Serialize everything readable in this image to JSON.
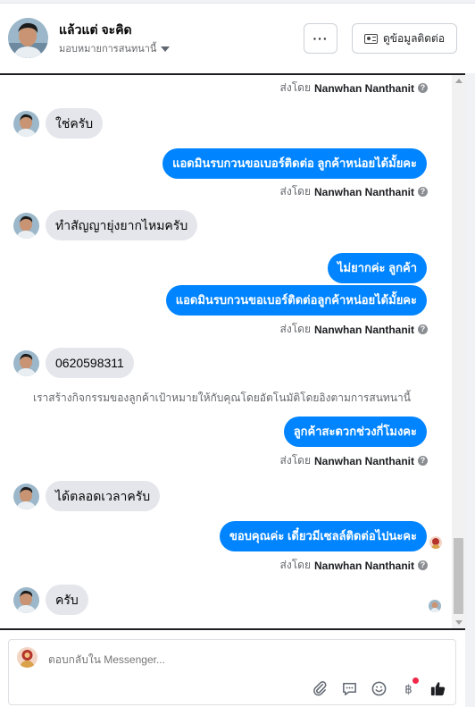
{
  "header": {
    "name": "แล้วแต่ จะคิด",
    "assign_label": "มอบหมายการสนทนานี้",
    "more_label": "···",
    "contact_label": "ดูข้อมูลติดต่อ"
  },
  "messages": {
    "sent_by_prefix": "ส่งโดย",
    "agent_name": "Nanwhan Nanthanit",
    "in_1": "ใช่ครับ",
    "out_1": "แอดมินรบกวนขอเบอร์ติดต่อ ลูกค้าหน่อยได้มั้ยคะ",
    "in_2": "ทำสัญญายุ่งยากไหมครับ",
    "out_2a": "ไม่ยากค่ะ ลูกค้า",
    "out_2b": "แอดมินรบกวนขอเบอร์ติดต่อลูกค้าหน่อยได้มั้ยคะ",
    "in_3": "0620598311",
    "system_note": "เราสร้างกิจกรรมของลูกค้าเป้าหมายให้กับคุณโดยอัตโนมัติโดยอิงตามการสนทนานี้",
    "out_3": "ลูกค้าสะดวกช่วงกี่โมงคะ",
    "in_4": "ได้ตลอดเวลาครับ",
    "out_4": "ขอบคุณค่ะ เดี๋ยวมีเซลล์ติดต่อไปนะคะ",
    "in_5": "ครับ"
  },
  "composer": {
    "placeholder": "ตอบกลับใน Messenger..."
  },
  "colors": {
    "outgoing_bubble": "#0084ff",
    "incoming_bubble": "#e4e6eb",
    "like": "#1c1e21"
  },
  "icons": [
    "more-icon",
    "contact-card-icon",
    "attach-icon",
    "saved-reply-icon",
    "emoji-icon",
    "payment-icon",
    "like-icon"
  ]
}
